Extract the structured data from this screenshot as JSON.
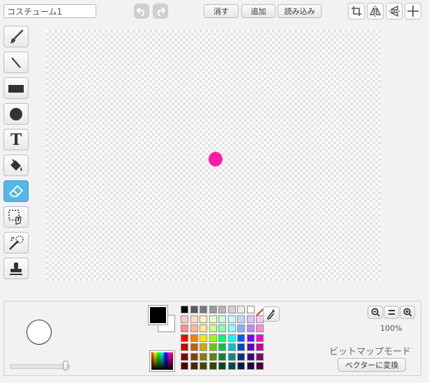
{
  "costume": {
    "name": "コスチューム1"
  },
  "toolbar": {
    "clear_label": "消す",
    "add_label": "追加",
    "import_label": "読み込み"
  },
  "tools": [
    {
      "name": "brush",
      "icon": "brush-icon"
    },
    {
      "name": "line",
      "icon": "line-icon"
    },
    {
      "name": "rectangle",
      "icon": "rectangle-icon"
    },
    {
      "name": "ellipse",
      "icon": "ellipse-icon"
    },
    {
      "name": "text",
      "icon": "text-icon",
      "glyph": "T"
    },
    {
      "name": "fill",
      "icon": "paint-bucket-icon"
    },
    {
      "name": "eraser",
      "icon": "eraser-icon",
      "active": true
    },
    {
      "name": "select",
      "icon": "select-icon"
    },
    {
      "name": "magic-wand",
      "icon": "magic-wand-icon"
    },
    {
      "name": "stamp",
      "icon": "stamp-icon"
    }
  ],
  "canvas": {
    "dot_color": "#ff1aa7"
  },
  "colors": {
    "primary": "#000000",
    "secondary": "#ffffff",
    "active_tool": "#53b8e8",
    "palette": [
      [
        "#000000",
        "#5a5a5a",
        "#7a7a7a",
        "#9b9b9b",
        "#b7b7b7",
        "#d2d2d2",
        "#ececec",
        "#ffffff",
        "none"
      ],
      [
        "#ffc7c7",
        "#ffdcc4",
        "#fff5c4",
        "#e8ffc4",
        "#c4ffd9",
        "#c4ffff",
        "#c4d7ff",
        "#dcc4ff",
        "#ffc4f0"
      ],
      [
        "#ff8f8f",
        "#ffb98a",
        "#ffeb8a",
        "#cfff8a",
        "#8affb5",
        "#8affff",
        "#8aaeff",
        "#b98aff",
        "#ff8ae4"
      ],
      [
        "#ff0000",
        "#ff7a00",
        "#ffe600",
        "#9aff00",
        "#00ff66",
        "#00ffff",
        "#005aff",
        "#7a00ff",
        "#ff00cc"
      ],
      [
        "#c40000",
        "#c45e00",
        "#c4b000",
        "#76c400",
        "#00c44e",
        "#00c4c4",
        "#0045c4",
        "#5e00c4",
        "#c4009c"
      ],
      [
        "#8a0000",
        "#8a4200",
        "#8a7c00",
        "#538a00",
        "#008a37",
        "#008a8a",
        "#00308a",
        "#42008a",
        "#8a006e"
      ],
      [
        "#4a0000",
        "#4a2300",
        "#4a4200",
        "#2c4a00",
        "#004a1d",
        "#004a4a",
        "#001a4a",
        "#23004a",
        "#4a003b"
      ]
    ]
  },
  "zoom": {
    "level": "100%"
  },
  "mode": {
    "label": "ビットマップモード",
    "convert_label": "ベクターに変換"
  },
  "brush": {
    "size_slider": 1.0
  }
}
